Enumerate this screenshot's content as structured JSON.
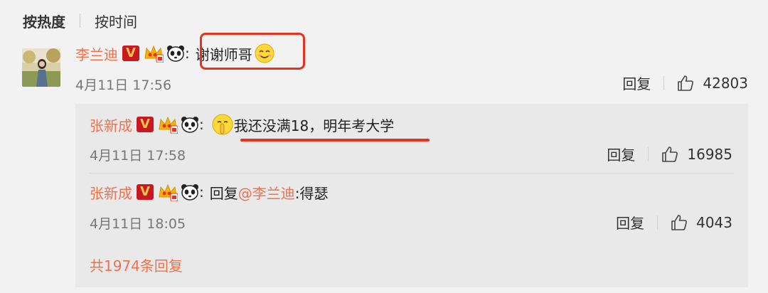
{
  "sort": {
    "active": "按热度",
    "other": "按时间"
  },
  "comment": {
    "user": "李兰迪",
    "vip_badge": "V",
    "colon": ":",
    "text": "谢谢师哥",
    "time": "4月11日 17:56",
    "reply_label": "回复",
    "likes": "42803"
  },
  "replies": [
    {
      "user": "张新成",
      "colon": ":",
      "text": "我还没满18，明年考大学",
      "time": "4月11日 17:58",
      "reply_label": "回复",
      "likes": "16985"
    },
    {
      "user": "张新成",
      "colon": ":",
      "prefix": "回复",
      "mention": "@李兰迪",
      "text": ":得瑟",
      "time": "4月11日 18:05",
      "reply_label": "回复",
      "likes": "4043"
    }
  ],
  "total_replies": "共1974条回复",
  "colors": {
    "accent": "#eb7350",
    "highlight": "#e8321f",
    "vip": "#c9181f"
  }
}
